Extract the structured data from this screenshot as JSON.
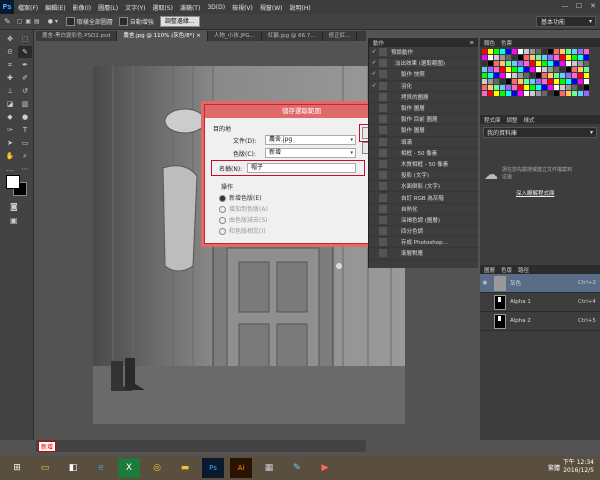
{
  "app": {
    "logo": "Ps"
  },
  "menu": [
    "檔案(F)",
    "編輯(E)",
    "影像(I)",
    "圖層(L)",
    "文字(Y)",
    "選取(S)",
    "濾鏡(T)",
    "3D(D)",
    "檢視(V)",
    "視窗(W)",
    "說明(H)"
  ],
  "options": {
    "sample_all": "取樣全部圖層",
    "auto_enhance": "自動增強",
    "refine_edge": "調整邊緣..."
  },
  "workspace": "基本功能",
  "tabs": [
    "農舍-黑白變彩色.PSD2.psd",
    "農舍.jpg @ 110% (灰色/8*) ×",
    "人物_小孩.JPG...",
    "紅鶴.jpg @ 66.7...",
    "修正紅..."
  ],
  "actions_panel": {
    "tab": "動作",
    "items": [
      {
        "label": "預設動作",
        "check": "✓"
      },
      {
        "label": "淡出效果 (選取範圍)",
        "check": "✓"
      },
      {
        "label": "製作 快照",
        "check": "✓"
      },
      {
        "label": "羽化",
        "check": "✓"
      },
      {
        "label": "拷貝的圖層",
        "check": ""
      },
      {
        "label": "製作 圖層",
        "check": ""
      },
      {
        "label": "製作 目前 圖層",
        "check": ""
      },
      {
        "label": "製作 圖層",
        "check": ""
      },
      {
        "label": "填滿",
        "check": ""
      },
      {
        "label": "相框 - 50 像素",
        "check": ""
      },
      {
        "label": "木質相框 - 50 像素",
        "check": ""
      },
      {
        "label": "投影 (文字)",
        "check": ""
      },
      {
        "label": "水面倒影 (文字)",
        "check": ""
      },
      {
        "label": "自訂 RGB 為灰階",
        "check": ""
      },
      {
        "label": "自熱化",
        "check": ""
      },
      {
        "label": "深褐色調 (圖層)",
        "check": ""
      },
      {
        "label": "四分色調",
        "check": ""
      },
      {
        "label": "存成 Photoshop...",
        "check": ""
      },
      {
        "label": "漸層對應",
        "check": ""
      }
    ]
  },
  "color_panel": {
    "tabs": [
      "顏色",
      "色票"
    ]
  },
  "properties_panel": {
    "tabs": [
      "程式庫",
      "調整",
      "樣式"
    ],
    "dropdown": "我的資料庫"
  },
  "cc_panel": {
    "text": "請在您先驗證或建立文件檔案到這邊",
    "link": "深入瞭解程式庫"
  },
  "layers_panel": {
    "tabs": [
      "圖層",
      "色版",
      "路徑"
    ],
    "channels": [
      {
        "name": "灰色",
        "shortcut": "Ctrl+2",
        "selected": true
      },
      {
        "name": "Alpha 1",
        "shortcut": "Ctrl+4",
        "selected": false
      },
      {
        "name": "Alpha 2",
        "shortcut": "Ctrl+5",
        "selected": false
      }
    ]
  },
  "dialog": {
    "title": "儲存選取範圍",
    "section_dest": "目的地",
    "doc_label": "文件(D):",
    "doc_value": "農舍.jpg",
    "channel_label": "色版(C):",
    "channel_value": "新增",
    "name_label": "名稱(N):",
    "name_value": "帽子",
    "ok": "確定",
    "cancel": "取消",
    "section_op": "操作",
    "ops": [
      "新增色版(E)",
      "增加到色版(A)",
      "由色版減去(S)",
      "和色版相交(I)"
    ]
  },
  "status": {
    "zoom_label": "新增"
  },
  "clock": {
    "time": "下午 12:34",
    "date": "2016/12/5"
  },
  "tray": "繁體"
}
